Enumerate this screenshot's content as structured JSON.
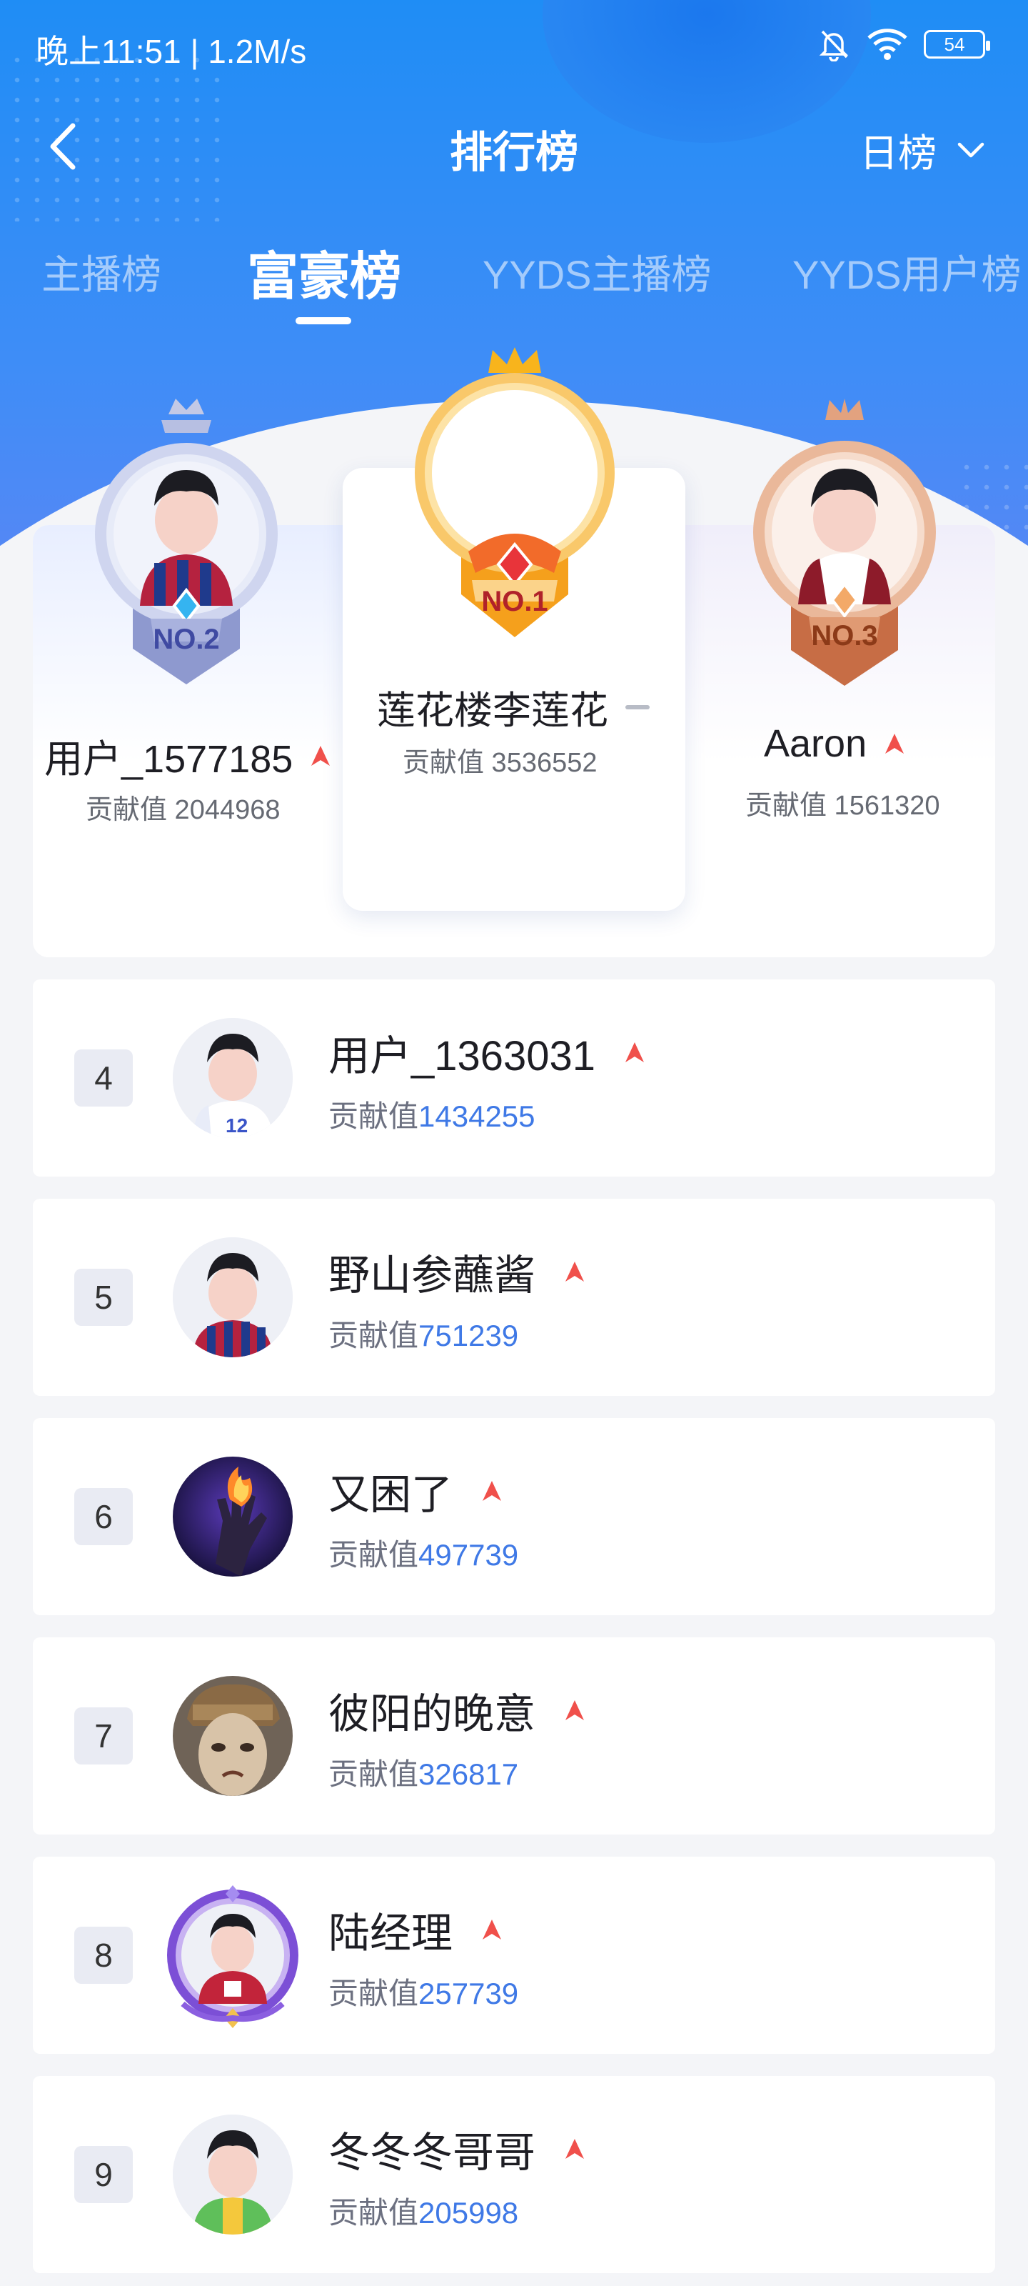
{
  "status_bar": {
    "time": "晚上11:51 | 1.2M/s",
    "battery": "54"
  },
  "nav": {
    "title": "排行榜",
    "period": "日榜"
  },
  "tabs": [
    {
      "label": "主播榜"
    },
    {
      "label": "富豪榜"
    },
    {
      "label": "YYDS主播榜"
    },
    {
      "label": "YYDS用户榜"
    }
  ],
  "active_tab": "富豪榜",
  "podium": {
    "first": {
      "rank_label": "NO.1",
      "name": "莲花楼李莲花",
      "score": "贡献值 3536552",
      "trend": "flat"
    },
    "second": {
      "rank_label": "NO.2",
      "name": "用户_1577185",
      "score": "贡献值 2044968",
      "trend": "up"
    },
    "third": {
      "rank_label": "NO.3",
      "name": "Aaron",
      "score": "贡献值 1561320",
      "trend": "up"
    }
  },
  "list_score_prefix": "贡献值",
  "ranks": [
    {
      "rank": "4",
      "name": "用户_1363031",
      "score": "1434255",
      "trend": "up",
      "avatar": "default-avatar-white-jersey"
    },
    {
      "rank": "5",
      "name": "野山参蘸酱",
      "score": "751239",
      "trend": "up",
      "avatar": "default-avatar-striped-jersey"
    },
    {
      "rank": "6",
      "name": "又困了",
      "score": "497739",
      "trend": "up",
      "avatar": "fire-hand-avatar"
    },
    {
      "rank": "7",
      "name": "彼阳的晚意",
      "score": "326817",
      "trend": "up",
      "avatar": "statue-face-avatar"
    },
    {
      "rank": "8",
      "name": "陆经理",
      "score": "257739",
      "trend": "up",
      "avatar": "purple-frame-avatar"
    },
    {
      "rank": "9",
      "name": "冬冬冬哥哥",
      "score": "205998",
      "trend": "up",
      "avatar": "default-avatar-yellow-green-jersey"
    }
  ],
  "colors": {
    "accent": "#3f79e6",
    "trend_up": "#f0504b",
    "header_blue": "#1f8df5"
  }
}
